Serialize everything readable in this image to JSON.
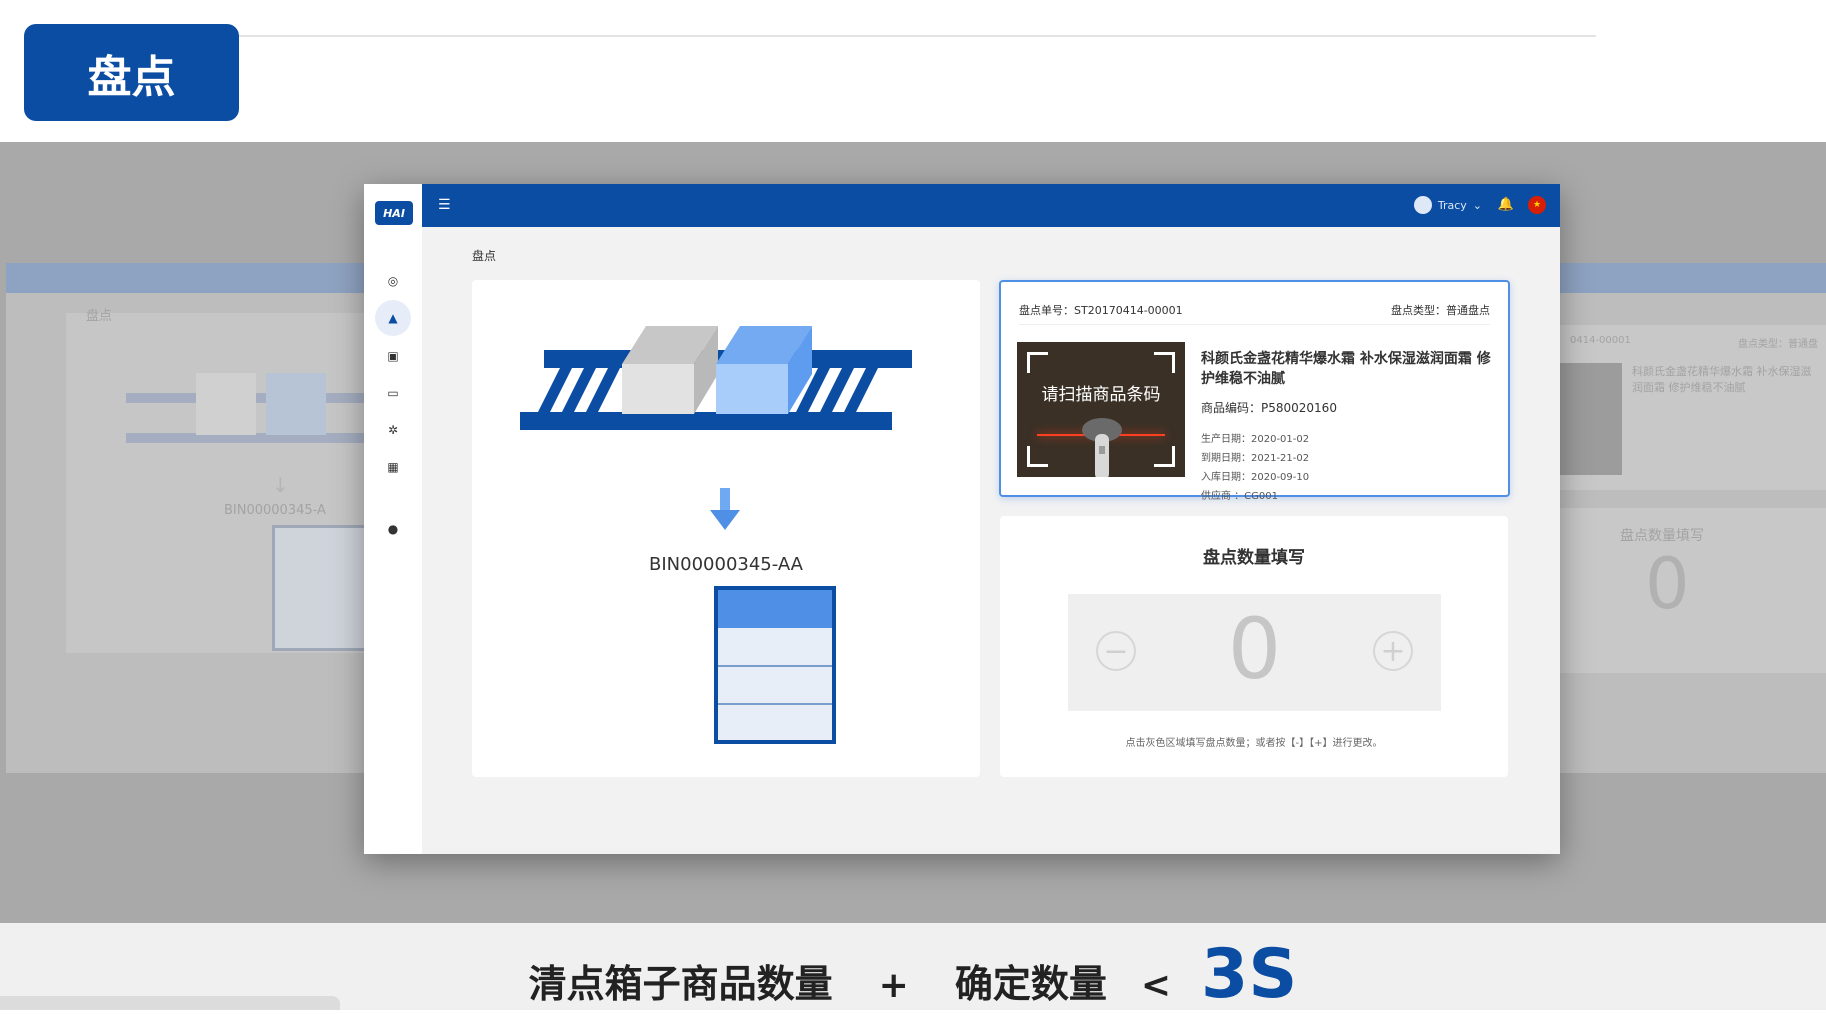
{
  "page": {
    "title": "盘点"
  },
  "app": {
    "logo": "HAI",
    "menu_icon": "hamburger-menu-icon",
    "user_name": "Tracy",
    "breadcrumb": "盘点",
    "sidebar_icons": [
      "dashboard-icon",
      "warehouse-icon",
      "inventory-icon",
      "monitor-icon",
      "settings-icon",
      "apps-icon",
      "help-icon"
    ]
  },
  "bin": {
    "label": "BIN00000345-AA"
  },
  "count_order": {
    "order_label": "盘点单号：ST20170414-00001",
    "type_label": "盘点类型：普通盘点",
    "scan_prompt": "请扫描商品条码",
    "product_name": "科颜氏金盏花精华爆水霜 补水保湿滋润面霜 修护维稳不油腻",
    "product_code": "商品编码：P580020160",
    "production_date": "生产日期：2020-01-02",
    "expiry_date": "到期日期：2021-21-02",
    "inbound_date": "入库日期：2020-09-10",
    "supplier": "供应商 ：CG001"
  },
  "quantity": {
    "title": "盘点数量填写",
    "value": "0",
    "minus": "−",
    "plus": "+",
    "hint": "点击灰色区域填写盘点数量；或者按【-】【+】进行更改。"
  },
  "ghost_right": {
    "order_fragment": "0414-00001",
    "type_label": "盘点类型：普通盘",
    "product_name": "科颜氏金盏花精华爆水霜 补水保湿滋润面霜 修护维稳不油腻",
    "qty_title": "盘点数量填写",
    "qty_value": "0"
  },
  "ghost_left": {
    "breadcrumb": "盘点",
    "bin_fragment": "BIN00000345-A"
  },
  "footer": {
    "part1": "清点箱子商品数量",
    "plus": "+",
    "part2": "确定数量",
    "lt": "<",
    "time": "3S"
  },
  "colors": {
    "brand_blue": "#0b4da2",
    "light_blue": "#a8cdfa",
    "accent_blue": "#4f8fe6",
    "gray_stage": "#a9a9a9"
  }
}
